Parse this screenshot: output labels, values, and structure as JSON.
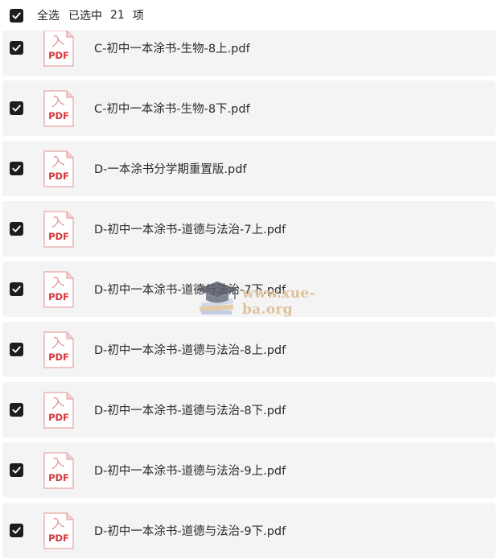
{
  "header": {
    "select_all_label": "全选",
    "selected_label": "已选中",
    "selected_count": "21",
    "unit_label": "项"
  },
  "icons": {
    "checkbox": "checkbox-checked-icon",
    "file": "pdf-file-icon",
    "file_label": "PDF"
  },
  "colors": {
    "checkbox_fill": "#1d1d1f",
    "row_background": "#f4f4f5",
    "pdf_red": "#d8363a"
  },
  "files": [
    {
      "name": "C-初中一本涂书-生物-8上.pdf"
    },
    {
      "name": "C-初中一本涂书-生物-8下.pdf"
    },
    {
      "name": "D-一本涂书分学期重置版.pdf"
    },
    {
      "name": "D-初中一本涂书-道德与法治-7上.pdf"
    },
    {
      "name": "D-初中一本涂书-道德与法治-7下.pdf"
    },
    {
      "name": "D-初中一本涂书-道德与法治-8上.pdf"
    },
    {
      "name": "D-初中一本涂书-道德与法治-8下.pdf"
    },
    {
      "name": "D-初中一本涂书-道德与法治-9上.pdf"
    },
    {
      "name": "D-初中一本涂书-道德与法治-9下.pdf"
    }
  ],
  "watermark": {
    "text": "www.xue-ba.org"
  }
}
